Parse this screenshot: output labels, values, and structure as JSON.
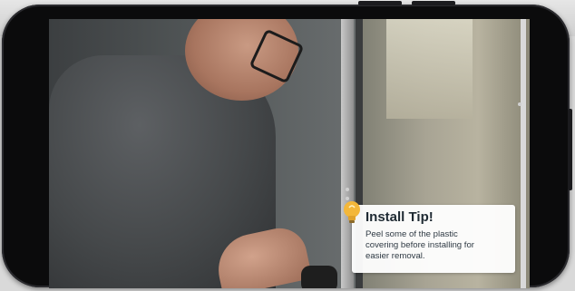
{
  "tip": {
    "title": "Install Tip!",
    "lines": [
      "Peel some of the plastic",
      "covering before installing for",
      "easier removal."
    ],
    "icon": "lightbulb-icon"
  },
  "colors": {
    "bulb": "#f3b73a",
    "phone_frame": "#0b0b0c",
    "card": "#ffffff"
  }
}
